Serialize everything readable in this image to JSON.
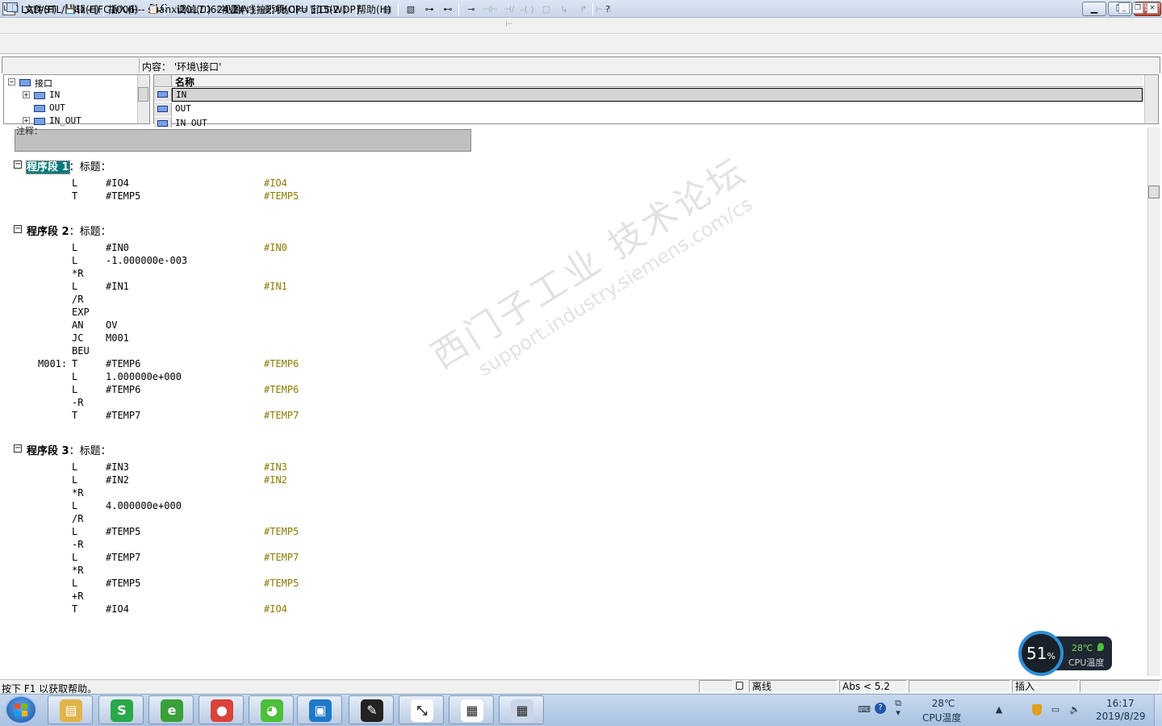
{
  "window": {
    "title": "LAD/STL/FBD  - [FC1006 -- suanxi20170624\\2#线拉矫机\\CPU 315-2 DP]",
    "app_icon_text": "LSF",
    "minimize": "▁",
    "maximize": "❐",
    "close": "✕"
  },
  "menu": {
    "items": [
      "文件(F)",
      "编辑(E)",
      "插入(I)",
      "PLC",
      "调试(D)",
      "视图(V)",
      "选项(O)",
      "窗口(W)",
      "帮助(H)"
    ],
    "mdi_min": "_",
    "mdi_restore": "❐",
    "mdi_close": "×"
  },
  "toolbar": {
    "icons": [
      "new-icon",
      "open-icon",
      "accessible-nodes-icon",
      "save-icon",
      "print-icon",
      "cut-icon",
      "copy-icon",
      "paste-icon",
      "undo-icon",
      "redo-icon",
      "download-icon",
      "monitor-icon",
      "address-icon",
      "compile-icon",
      "overview-icon",
      "ladder-icon",
      "step-back-icon",
      "step-forward-icon",
      "interface-view-icon",
      "details-icon",
      "network-new-icon",
      "branch-icon",
      "branch-close-icon",
      "contact-no-icon",
      "contact-nc-icon",
      "coil-icon",
      "box-icon",
      "open-branch-icon",
      "close-branch-icon",
      "connector-icon",
      "help-icon"
    ]
  },
  "interface": {
    "content_label": "内容：  '环境\\接口'",
    "tree": [
      {
        "label": "接口",
        "level": 0,
        "expander": "−"
      },
      {
        "label": "IN",
        "level": 1,
        "expander": "+"
      },
      {
        "label": "OUT",
        "level": 1,
        "expander": ""
      },
      {
        "label": "IN_OUT",
        "level": 1,
        "expander": "+"
      }
    ],
    "grid_header": "名称",
    "grid_rows": [
      "IN",
      "OUT",
      "IN_OUT"
    ]
  },
  "editor": {
    "comment_label": "注释：",
    "networks": [
      {
        "toggle": "−",
        "name": "程序段 1",
        "title": "：标题：",
        "lines": [
          {
            "label": "",
            "op": "L",
            "arg": "#IO4",
            "sym": "#IO4"
          },
          {
            "label": "",
            "op": "T",
            "arg": "#TEMP5",
            "sym": "#TEMP5"
          }
        ]
      },
      {
        "toggle": "−",
        "name": "程序段 2",
        "title": "：标题：",
        "lines": [
          {
            "label": "",
            "op": "L",
            "arg": "#IN0",
            "sym": "#IN0"
          },
          {
            "label": "",
            "op": "L",
            "arg": "-1.000000e-003",
            "sym": ""
          },
          {
            "label": "",
            "op": "*R",
            "arg": "",
            "sym": ""
          },
          {
            "label": "",
            "op": "L",
            "arg": "#IN1",
            "sym": "#IN1"
          },
          {
            "label": "",
            "op": "/R",
            "arg": "",
            "sym": ""
          },
          {
            "label": "",
            "op": "EXP",
            "arg": "",
            "sym": ""
          },
          {
            "label": "",
            "op": "AN",
            "arg": "OV",
            "sym": ""
          },
          {
            "label": "",
            "op": "JC",
            "arg": "M001",
            "sym": ""
          },
          {
            "label": "",
            "op": "BEU",
            "arg": "",
            "sym": ""
          },
          {
            "label": "M001:",
            "op": "T",
            "arg": "#TEMP6",
            "sym": "#TEMP6"
          },
          {
            "label": "",
            "op": "L",
            "arg": "1.000000e+000",
            "sym": ""
          },
          {
            "label": "",
            "op": "L",
            "arg": "#TEMP6",
            "sym": "#TEMP6"
          },
          {
            "label": "",
            "op": "-R",
            "arg": "",
            "sym": ""
          },
          {
            "label": "",
            "op": "T",
            "arg": "#TEMP7",
            "sym": "#TEMP7"
          }
        ]
      },
      {
        "toggle": "−",
        "name": "程序段 3",
        "title": "：标题：",
        "lines": [
          {
            "label": "",
            "op": "L",
            "arg": "#IN3",
            "sym": "#IN3"
          },
          {
            "label": "",
            "op": "L",
            "arg": "#IN2",
            "sym": "#IN2"
          },
          {
            "label": "",
            "op": "*R",
            "arg": "",
            "sym": ""
          },
          {
            "label": "",
            "op": "L",
            "arg": "4.000000e+000",
            "sym": ""
          },
          {
            "label": "",
            "op": "/R",
            "arg": "",
            "sym": ""
          },
          {
            "label": "",
            "op": "L",
            "arg": "#TEMP5",
            "sym": "#TEMP5"
          },
          {
            "label": "",
            "op": "-R",
            "arg": "",
            "sym": ""
          },
          {
            "label": "",
            "op": "L",
            "arg": "#TEMP7",
            "sym": "#TEMP7"
          },
          {
            "label": "",
            "op": "*R",
            "arg": "",
            "sym": ""
          },
          {
            "label": "",
            "op": "L",
            "arg": "#TEMP5",
            "sym": "#TEMP5"
          },
          {
            "label": "",
            "op": "+R",
            "arg": "",
            "sym": ""
          },
          {
            "label": "",
            "op": "T",
            "arg": "#IO4",
            "sym": "#IO4"
          }
        ]
      }
    ],
    "watermark_cn": "西门子工业 技术论坛",
    "watermark_en": "support.industry.siemens.com/cs"
  },
  "cpu_widget": {
    "percent": "51",
    "percent_sign": "%",
    "temp": "28℃",
    "label": "CPU温度",
    "ring_color": "#2d8fd6"
  },
  "status": {
    "help": "按下 F1 以获取帮助。",
    "mode": "离线",
    "abs": "Abs < 5.2",
    "insert": "插入"
  },
  "taskbar": {
    "apps": [
      {
        "name": "explorer",
        "color": "#e0b44a",
        "glyph": "▤"
      },
      {
        "name": "wps-sheet",
        "color": "#2aa84a",
        "glyph": "S"
      },
      {
        "name": "browser-360",
        "color": "#3aa03a",
        "glyph": "e"
      },
      {
        "name": "chrome",
        "color": "#d9433a",
        "glyph": "●"
      },
      {
        "name": "wechat",
        "color": "#4cbf3b",
        "glyph": "◕"
      },
      {
        "name": "vm-app",
        "color": "#1e79c8",
        "glyph": "▣"
      },
      {
        "name": "simatic-manager",
        "color": "#222222",
        "glyph": "✎"
      },
      {
        "name": "simatic-tool",
        "color": "#ffffff",
        "glyph": "⤡"
      },
      {
        "name": "lad-stl-fbd",
        "color": "#ffffff",
        "glyph": "▦"
      },
      {
        "name": "calculator",
        "color": "#c9d6e8",
        "glyph": "▦"
      }
    ],
    "tray_temp": "28℃",
    "tray_temp_label": "CPU温度",
    "time": "16:17",
    "date": "2019/8/29"
  }
}
